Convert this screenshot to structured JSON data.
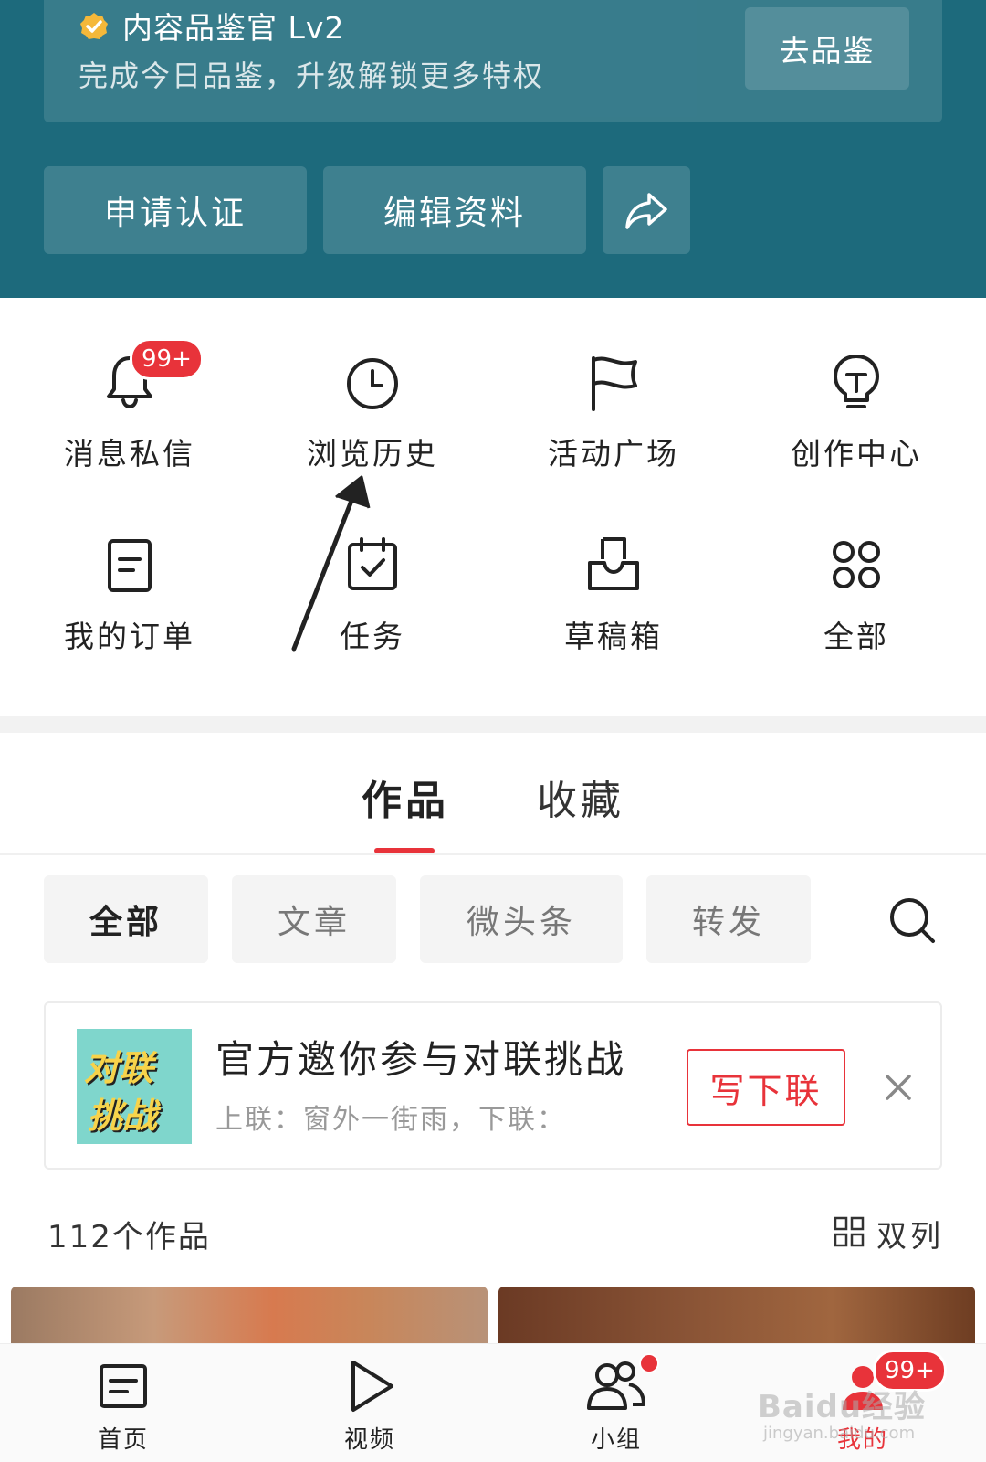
{
  "header": {
    "level_title": "内容品鉴官 Lv2",
    "level_subtitle": "完成今日品鉴，升级解锁更多特权",
    "go_button": "去品鉴",
    "apply_cert": "申请认证",
    "edit_profile": "编辑资料",
    "share_icon": "share-icon",
    "background_color": "#1d6a7c"
  },
  "grid": {
    "items": [
      {
        "label": "消息私信",
        "icon": "bell-icon",
        "badge": "99+"
      },
      {
        "label": "浏览历史",
        "icon": "clock-icon"
      },
      {
        "label": "活动广场",
        "icon": "flag-icon"
      },
      {
        "label": "创作中心",
        "icon": "lightbulb-icon"
      },
      {
        "label": "我的订单",
        "icon": "document-icon"
      },
      {
        "label": "任务",
        "icon": "calendar-check-icon"
      },
      {
        "label": "草稿箱",
        "icon": "inbox-icon"
      },
      {
        "label": "全部",
        "icon": "grid-circles-icon"
      }
    ]
  },
  "tabs": {
    "active": "作品",
    "inactive": "收藏"
  },
  "filters": {
    "chips": [
      "全部",
      "文章",
      "微头条",
      "转发"
    ],
    "search_icon": "search-icon"
  },
  "promo": {
    "thumb_line1": "对联",
    "thumb_line2": "挑战",
    "title": "官方邀你参与对联挑战",
    "subtitle": "上联：窗外一街雨，下联：",
    "button": "写下联",
    "close_icon": "close-icon"
  },
  "works": {
    "count_label": "112个作品",
    "layout_label": "双列"
  },
  "bottom_nav": {
    "items": [
      {
        "label": "首页",
        "icon": "news-icon"
      },
      {
        "label": "视频",
        "icon": "play-icon"
      },
      {
        "label": "小组",
        "icon": "group-icon"
      },
      {
        "label": "我的",
        "icon": "profile-icon",
        "badge": "99+"
      }
    ]
  },
  "watermark": {
    "text": "Baidu经验",
    "url_text": "jingyan.baidu.com"
  },
  "colors": {
    "accent": "#e8333a",
    "teal": "#1d6a7c"
  }
}
